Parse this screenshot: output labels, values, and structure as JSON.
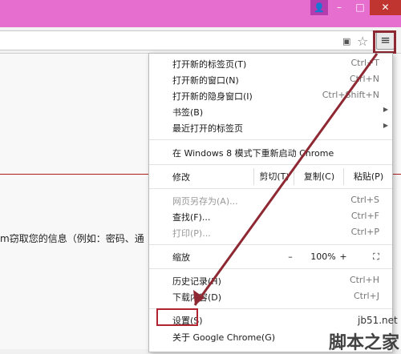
{
  "titlebar": {
    "minimize": "–",
    "maximize": "□",
    "close": "✕",
    "user_icon": "user-icon"
  },
  "toolbar": {
    "page_icon": "page-icon",
    "star_icon": "star-icon",
    "menu_icon": "hamburger-menu-icon"
  },
  "page": {
    "text": "m窃取您的信息（例如：密码、通"
  },
  "menu": {
    "new_tab": {
      "label": "打开新的标签页(T)",
      "shortcut": "Ctrl+T"
    },
    "new_window": {
      "label": "打开新的窗口(N)",
      "shortcut": "Ctrl+N"
    },
    "new_incognito": {
      "label": "打开新的隐身窗口(I)",
      "shortcut": "Ctrl+Shift+N"
    },
    "bookmarks": {
      "label": "书签(B)"
    },
    "recent_tabs": {
      "label": "最近打开的标签页"
    },
    "relaunch": {
      "label": "在 Windows 8 模式下重新启动 Chrome"
    },
    "edit": {
      "label": "修改",
      "cut": "剪切(T)",
      "copy": "复制(C)",
      "paste": "粘贴(P)"
    },
    "save_as": {
      "label": "网页另存为(A)...",
      "shortcut": "Ctrl+S"
    },
    "find": {
      "label": "查找(F)...",
      "shortcut": "Ctrl+F"
    },
    "print": {
      "label": "打印(P)...",
      "shortcut": "Ctrl+P"
    },
    "zoom": {
      "label": "缩放",
      "minus": "–",
      "value": "100%",
      "plus": "+",
      "fullscreen": "⛶"
    },
    "history": {
      "label": "历史记录(H)",
      "shortcut": "Ctrl+H"
    },
    "downloads": {
      "label": "下载内容(D)",
      "shortcut": "Ctrl+J"
    },
    "settings": {
      "label": "设置(S)"
    },
    "about": {
      "label": "关于 Google Chrome(G)"
    }
  },
  "watermark": {
    "site": "jb51.net",
    "brand": "脚本之家"
  }
}
